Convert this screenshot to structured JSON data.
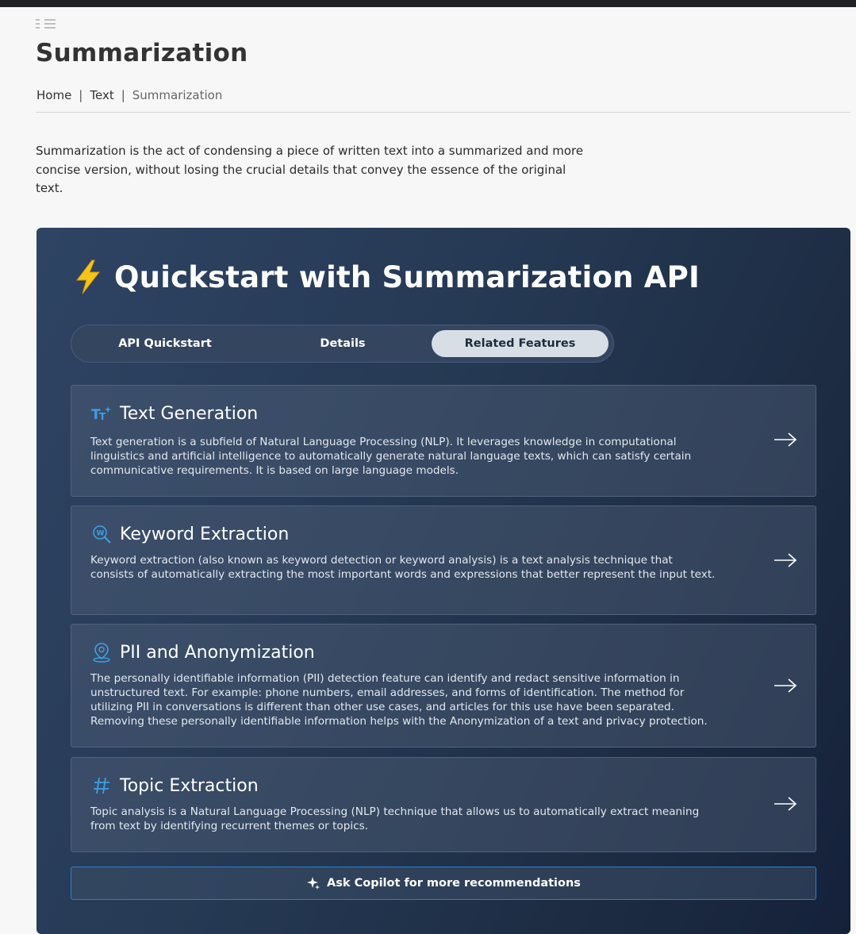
{
  "page": {
    "title": "Summarization",
    "breadcrumb": [
      "Home",
      "Text",
      "Summarization"
    ],
    "breadcrumb_separator": "|",
    "intro": "Summarization is the act of condensing a piece of written text into a summarized and more concise version, without losing the crucial details that convey the essence of the original text."
  },
  "panel": {
    "icon": "lightning-bolt-icon",
    "title": "Quickstart with Summarization API",
    "tabs": [
      {
        "label": "API Quickstart",
        "active": false
      },
      {
        "label": "Details",
        "active": false
      },
      {
        "label": "Related Features",
        "active": true
      }
    ],
    "cards": [
      {
        "icon": "text-generation-icon",
        "title": "Text Generation",
        "description": "Text generation is a subfield of Natural Language Processing (NLP). It leverages knowledge in computational linguistics and artificial intelligence to automatically generate natural language texts, which can satisfy certain communicative requirements. It is based on large language models."
      },
      {
        "icon": "keyword-search-icon",
        "title": "Keyword Extraction",
        "description": "Keyword extraction (also known as keyword detection or keyword analysis) is a text analysis technique that consists of automatically extracting the most important words and expressions that better represent the input text."
      },
      {
        "icon": "person-location-icon",
        "title": "PII and Anonymization",
        "description": "The personally identifiable information (PII) detection feature can identify and redact sensitive information in unstructured text. For example: phone numbers, email addresses, and forms of identification. The method for utilizing PII in conversations is different than other use cases, and articles for this use have been separated. Removing these personally identifiable information helps with the Anonymization of a text and privacy protection."
      },
      {
        "icon": "hashtag-icon",
        "title": "Topic Extraction",
        "description": "Topic analysis is a Natural Language Processing (NLP) technique that allows us to automatically extract meaning from text by identifying recurrent themes or topics."
      }
    ],
    "copilot_label": "Ask Copilot for more recommendations"
  },
  "colors": {
    "accent": "#3da0e8",
    "bolt": "#f5c518",
    "panel_bg": "#263a55",
    "active_tab": "#d7dee6"
  }
}
